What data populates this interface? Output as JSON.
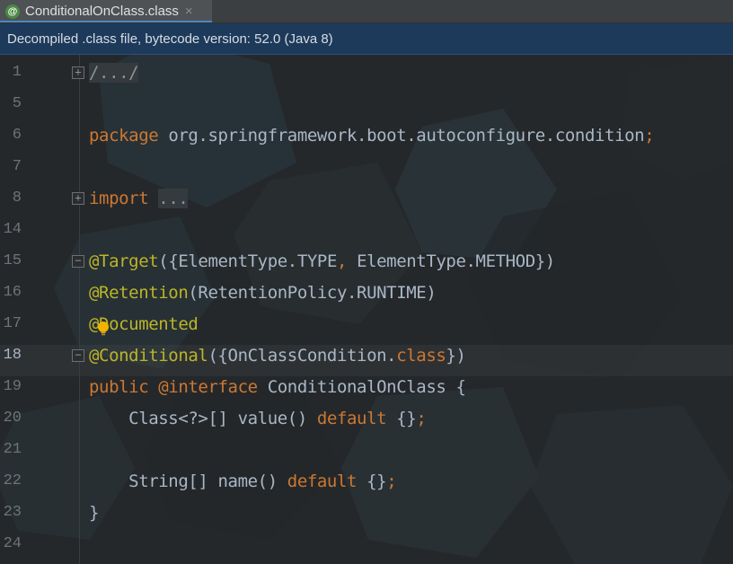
{
  "tab": {
    "icon_label": "@",
    "title": "ConditionalOnClass.class",
    "close": "×"
  },
  "banner": {
    "text": "Decompiled .class file, bytecode version: 52.0 (Java 8)"
  },
  "editor": {
    "current_line": "18",
    "lines": [
      {
        "num": "1",
        "tokens": [
          "/.../"
        ]
      },
      {
        "num": "5",
        "tokens": []
      },
      {
        "num": "6",
        "tokens": [
          "package",
          " org.springframework.boot.autoconfigure.condition",
          ";"
        ]
      },
      {
        "num": "7",
        "tokens": []
      },
      {
        "num": "8",
        "tokens": [
          "import",
          " ",
          "..."
        ]
      },
      {
        "num": "14",
        "tokens": []
      },
      {
        "num": "15",
        "tokens": [
          "@Target",
          "({ElementType.TYPE",
          ", ",
          "ElementType.METHOD})"
        ]
      },
      {
        "num": "16",
        "tokens": [
          "@Retention",
          "(RetentionPolicy.RUNTIME)"
        ]
      },
      {
        "num": "17",
        "tokens": [
          "@Documented"
        ]
      },
      {
        "num": "18",
        "tokens": [
          "@Conditional",
          "({OnClassCondition.",
          "class",
          "})"
        ]
      },
      {
        "num": "19",
        "tokens": [
          "public",
          " ",
          "@interface",
          " ConditionalOnClass {"
        ]
      },
      {
        "num": "20",
        "tokens": [
          "    Class<?>[] value() ",
          "default",
          " {}",
          ";"
        ]
      },
      {
        "num": "21",
        "tokens": []
      },
      {
        "num": "22",
        "tokens": [
          "    String[] name() ",
          "default",
          " {}",
          ";"
        ]
      },
      {
        "num": "23",
        "tokens": [
          "}"
        ]
      },
      {
        "num": "24",
        "tokens": []
      }
    ],
    "fold_expand_glyph": "+",
    "fold_collapse_glyph": "−"
  },
  "colors": {
    "keyword": "#cc7832",
    "annotation": "#bbb529",
    "text": "#a9b7c6",
    "banner_bg": "#1d3a5a",
    "tab_accent": "#4a88c7"
  }
}
